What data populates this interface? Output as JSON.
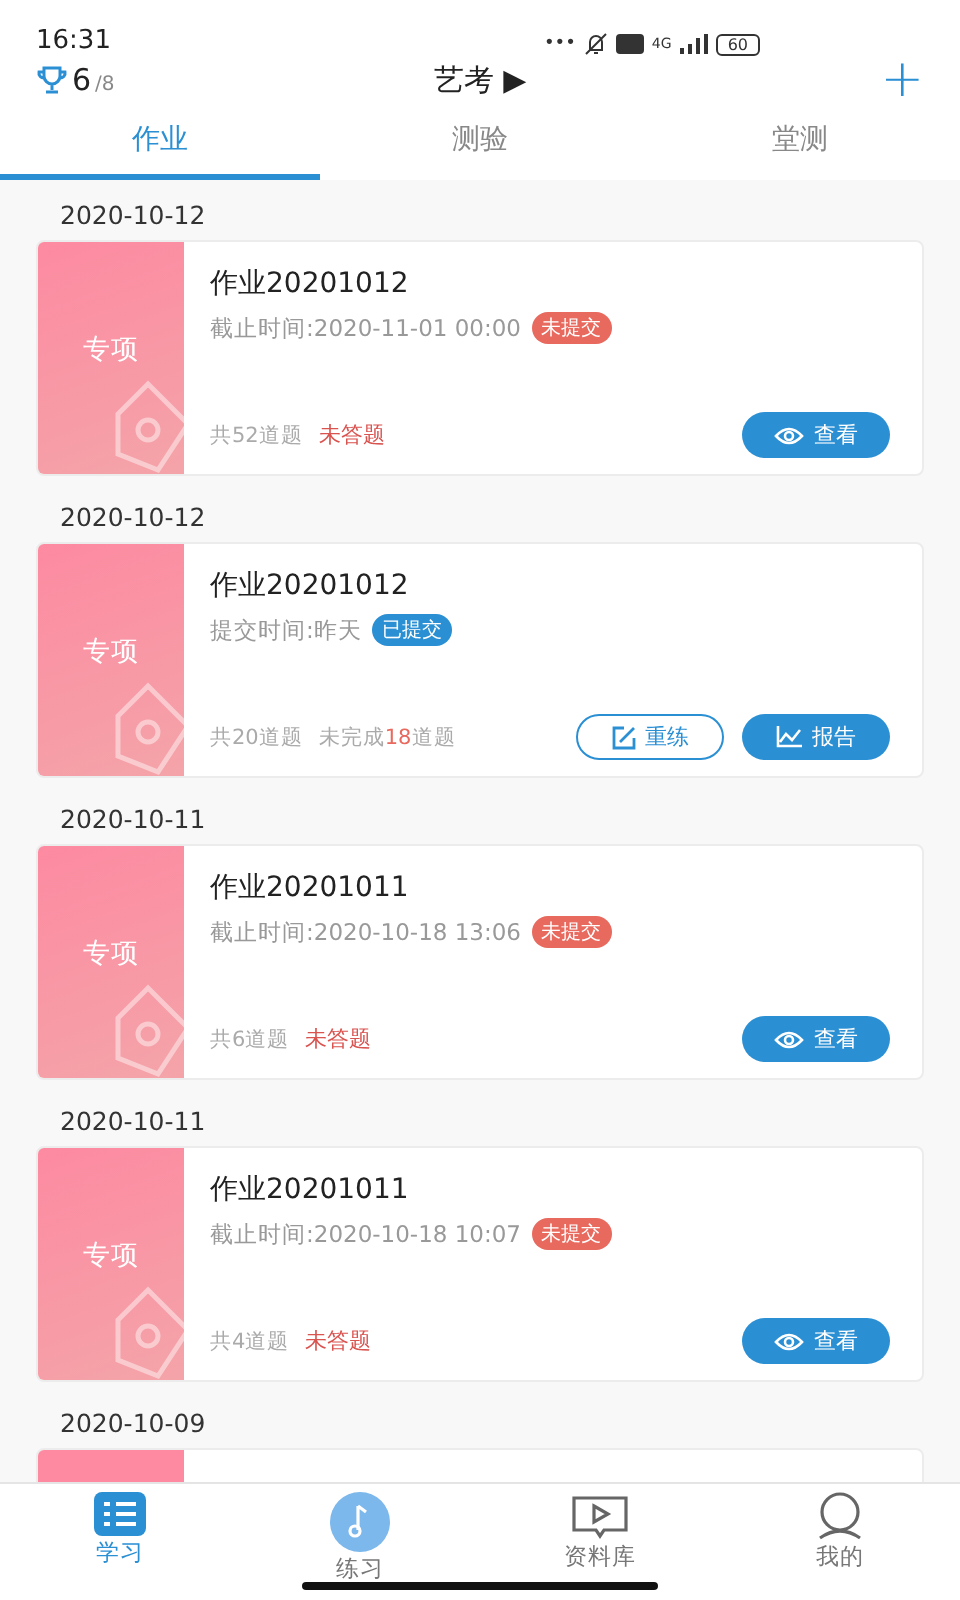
{
  "status_bar": {
    "time": "16:31",
    "dots": "•••",
    "network": "4G",
    "battery": "60"
  },
  "header": {
    "score": "6",
    "score_total": "/8",
    "title": "艺考",
    "caret": "▶",
    "add": "+"
  },
  "tabs": [
    {
      "label": "作业",
      "selected": true
    },
    {
      "label": "测验",
      "selected": false
    },
    {
      "label": "堂测",
      "selected": false
    }
  ],
  "assignments": [
    {
      "kind": "pending",
      "date": "2020-10-12",
      "category": "专项",
      "title": "作业20201012",
      "time": "截止时间:2020-11-01 00:00",
      "status": {
        "label": "未提交",
        "submitted": false
      },
      "total": "共52道题",
      "progress": "未答题",
      "buttons": [
        {
          "kind": "view",
          "label": "查看"
        }
      ]
    },
    {
      "kind": "submitted",
      "date": "2020-10-12",
      "category": "专项",
      "title": "作业20201012",
      "time": "提交时间:昨天",
      "status": {
        "label": "已提交",
        "submitted": true
      },
      "total": "共20道题",
      "remaining": {
        "prefix": "未完成",
        "count": "18",
        "suffix": "道题"
      },
      "buttons": [
        {
          "kind": "redo",
          "label": "重练"
        },
        {
          "kind": "report",
          "label": "报告"
        }
      ]
    },
    {
      "kind": "pending",
      "date": "2020-10-11",
      "category": "专项",
      "title": "作业20201011",
      "time": "截止时间:2020-10-18 13:06",
      "status": {
        "label": "未提交",
        "submitted": false
      },
      "total": "共6道题",
      "progress": "未答题",
      "buttons": [
        {
          "kind": "view",
          "label": "查看"
        }
      ]
    },
    {
      "kind": "pending",
      "date": "2020-10-11",
      "category": "专项",
      "title": "作业20201011",
      "time": "截止时间:2020-10-18 10:07",
      "status": {
        "label": "未提交",
        "submitted": false
      },
      "total": "共4道题",
      "progress": "未答题",
      "buttons": [
        {
          "kind": "view",
          "label": "查看"
        }
      ]
    },
    {
      "kind": "cut",
      "date": "2020-10-09"
    }
  ],
  "bottom_nav": [
    {
      "kind": "study",
      "label": "学习",
      "selected": true
    },
    {
      "kind": "practice",
      "label": "练习",
      "selected": false
    },
    {
      "kind": "library",
      "label": "资料库",
      "selected": false
    },
    {
      "kind": "profile",
      "label": "我的",
      "selected": false
    }
  ]
}
